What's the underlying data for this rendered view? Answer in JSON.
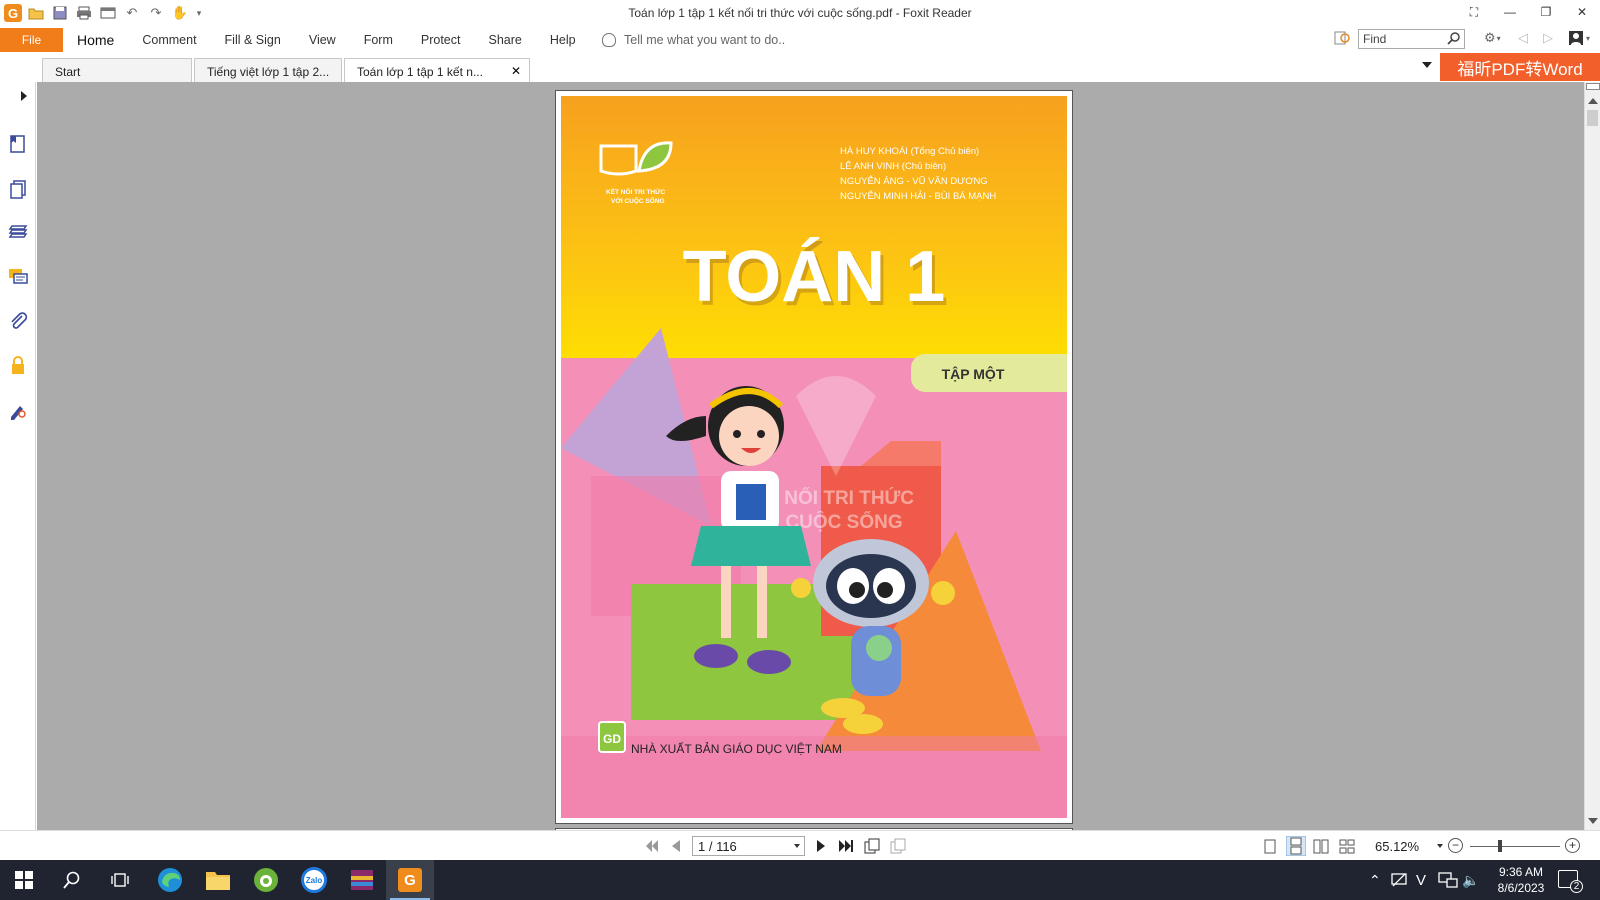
{
  "window": {
    "title": "Toán lớp 1 tập 1 kết nối tri thức với cuộc sống.pdf - Foxit Reader"
  },
  "ribbon": {
    "file_label": "File",
    "tabs": [
      "Home",
      "Comment",
      "Fill & Sign",
      "View",
      "Form",
      "Protect",
      "Share",
      "Help"
    ],
    "tell_me_placeholder": "Tell me what you want to do..",
    "find_placeholder": "Find"
  },
  "doc_tabs": [
    {
      "label": "Start"
    },
    {
      "label": "Tiếng việt lớp 1 tập 2..."
    },
    {
      "label": "Toán lớp 1 tập 1 kết n..."
    }
  ],
  "banner": {
    "label": "福昕PDF转Word"
  },
  "cover": {
    "authors": [
      "HÀ HUY KHOÁI (Tổng Chủ biên)",
      "LÊ ANH VINH (Chủ biên)",
      "NGUYỄN ÁNG - VŨ VĂN DƯƠNG",
      "NGUYỄN MINH HẢI - BÙI BÁ MẠNH"
    ],
    "logo_text_line1": "KẾT NỐI TRI THỨC",
    "logo_text_line2": "VỚI CUỘC SỐNG",
    "title": "TOÁN 1",
    "volume": "TẬP MỘT",
    "watermark_line1": "KẾT NỐI TRI THỨC",
    "watermark_line2": "VỚI CUỘC SỐNG",
    "publisher_logo": "GD",
    "publisher": "NHÀ XUẤT BẢN GIÁO DỤC VIỆT NAM"
  },
  "status": {
    "page_value": "1 / 116",
    "zoom": "65.12%"
  },
  "taskbar": {
    "time": "9:36 AM",
    "date": "8/6/2023",
    "notifications": "2",
    "zalo_label": "Zalo"
  },
  "colors": {
    "accent": "#f07c1a",
    "cover_orange": "#f7a11e",
    "cover_yellow": "#ffd400",
    "cover_pink": "#f48fb8",
    "taskbar": "#1f2430"
  }
}
